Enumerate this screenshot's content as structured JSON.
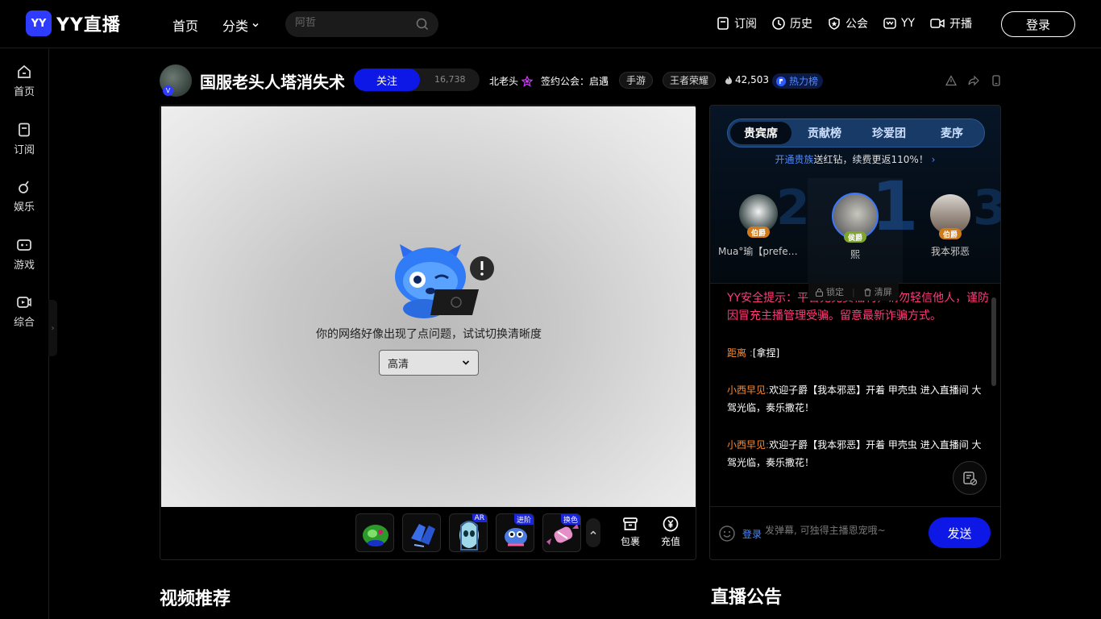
{
  "app": {
    "logo_badge": "YY",
    "logo_text": "YY直播"
  },
  "topnav": {
    "home": "首页",
    "category": "分类",
    "search_placeholder": "阿哲",
    "actions": [
      {
        "label": "订阅",
        "icon": "bookmark-icon"
      },
      {
        "label": "历史",
        "icon": "clock-icon"
      },
      {
        "label": "公会",
        "icon": "star-shield-icon"
      },
      {
        "label": "YY",
        "icon": "yy-icon"
      },
      {
        "label": "开播",
        "icon": "camera-icon"
      }
    ],
    "login": "登录"
  },
  "sidebar": {
    "items": [
      {
        "label": "首页",
        "icon": "home-icon"
      },
      {
        "label": "订阅",
        "icon": "bookmark-icon"
      },
      {
        "label": "娱乐",
        "icon": "music-icon"
      },
      {
        "label": "游戏",
        "icon": "gamepad-icon"
      },
      {
        "label": "综合",
        "icon": "play-icon"
      }
    ],
    "toggle": "›"
  },
  "room": {
    "title": "国服老头人塔消失术",
    "follow_label": "关注",
    "follower_count": "16,738",
    "host_name": "北老头",
    "guild": "签约公会：启遇",
    "tags": [
      "手游",
      "王者荣耀"
    ],
    "heat": "42,503",
    "rank_label": "热力榜"
  },
  "player": {
    "error_message": "你的网络好像出现了点问题，试试切换清晰度",
    "quality_selected": "高清",
    "gifts": [
      {
        "name": "gift-1",
        "badge": ""
      },
      {
        "name": "gift-2",
        "badge": ""
      },
      {
        "name": "gift-3",
        "badge": "AR"
      },
      {
        "name": "gift-4",
        "badge": "进阶"
      },
      {
        "name": "gift-5",
        "badge": "换色"
      }
    ],
    "package_label": "包裹",
    "recharge_label": "充值"
  },
  "panel": {
    "tabs": [
      "贵宾席",
      "贡献榜",
      "珍爱团",
      "麦序"
    ],
    "active_tab": 0,
    "promo_link": "开通贵族",
    "promo_text": "送红钻，续费更返110%！",
    "seats": [
      {
        "rank_num": "2",
        "rank_title": "伯爵",
        "name": "Mua°瑜【prefere…"
      },
      {
        "rank_num": "1",
        "rank_title": "侯爵",
        "name": "熙"
      },
      {
        "rank_num": "3",
        "rank_title": "伯爵",
        "name": "我本邪恶"
      }
    ],
    "lock_label": "锁定",
    "clear_label": "清屏",
    "safety_notice": "YY安全提示：平台无免费福利，请勿轻信他人，谨防因冒充主播管理受骗。留意最新诈骗方式。",
    "messages": [
      {
        "user": "距离",
        "text": "[拿捏]"
      },
      {
        "user": "小西早见",
        "text": "欢迎子爵【我本邪恶】开着 甲壳虫 进入直播间 大驾光临，奏乐撒花！"
      },
      {
        "user": "小西早见",
        "text": "欢迎子爵【我本邪恶】开着 甲壳虫 进入直播间 大驾光临，奏乐撒花！"
      }
    ],
    "login_link": "登录",
    "input_placeholder": "发弹幕, 可独得主播恩宠哦~",
    "send_label": "发送"
  },
  "sections": {
    "video_recommend": "视频推荐",
    "announcement": "直播公告"
  },
  "colors": {
    "brand_blue": "#0d18e6",
    "link_blue": "#4f8bff",
    "safety_pink": "#ff3c7a",
    "username_orange": "#ff8a2c"
  }
}
